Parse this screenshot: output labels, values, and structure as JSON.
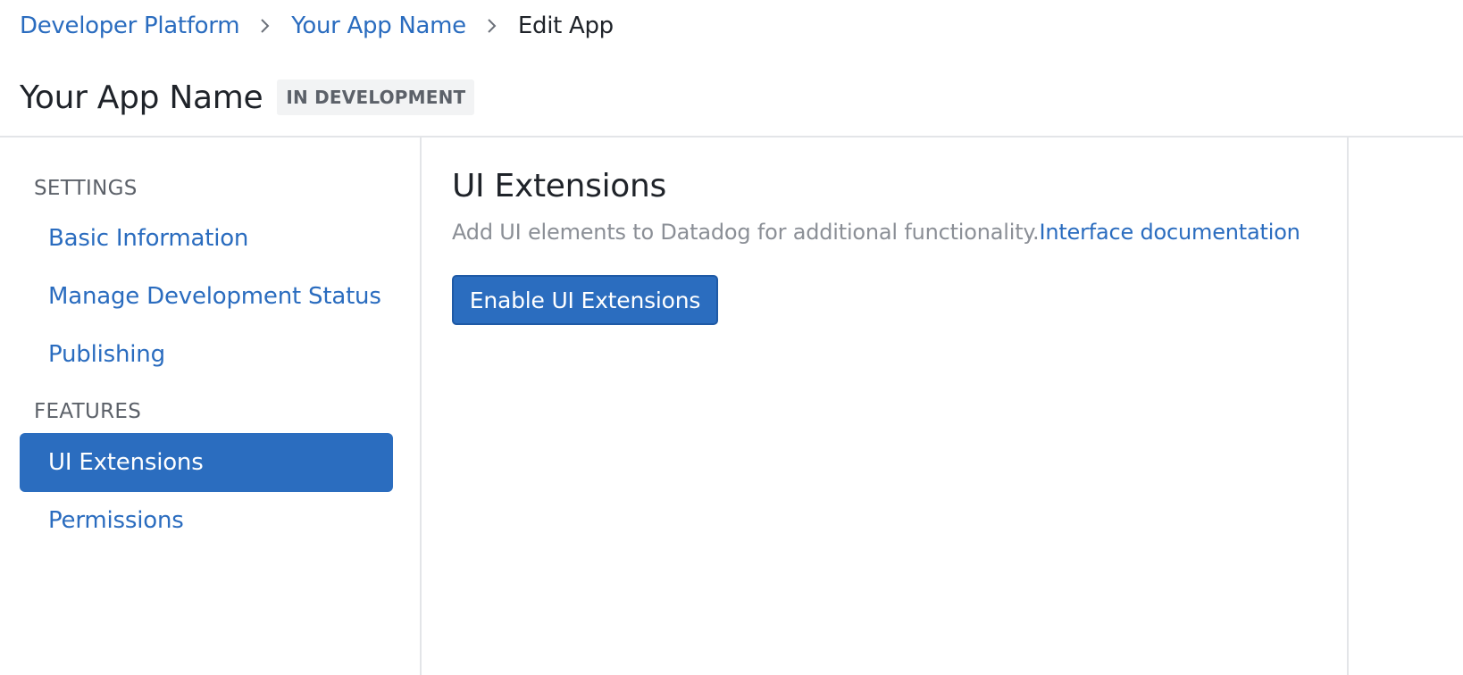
{
  "breadcrumb": {
    "items": [
      {
        "label": "Developer Platform"
      },
      {
        "label": "Your App Name"
      },
      {
        "label": "Edit App"
      }
    ],
    "separator_icon": "chevron-right-icon"
  },
  "header": {
    "title": "Your App Name",
    "status_badge": "IN DEVELOPMENT"
  },
  "sidebar": {
    "sections": [
      {
        "heading": "SETTINGS",
        "items": [
          {
            "label": "Basic Information",
            "active": false
          },
          {
            "label": "Manage Development Status",
            "active": false
          },
          {
            "label": "Publishing",
            "active": false
          }
        ]
      },
      {
        "heading": "FEATURES",
        "items": [
          {
            "label": "UI Extensions",
            "active": true
          },
          {
            "label": "Permissions",
            "active": false
          }
        ]
      }
    ]
  },
  "main": {
    "title": "UI Extensions",
    "description": "Add UI elements to Datadog for additional functionality.",
    "doc_link": "Interface documentation",
    "enable_button": "Enable UI Extensions"
  },
  "colors": {
    "accent": "#2b6dbf",
    "link": "#2a6cbf",
    "muted_text": "#8b8f96",
    "badge_bg": "#f2f3f4"
  }
}
